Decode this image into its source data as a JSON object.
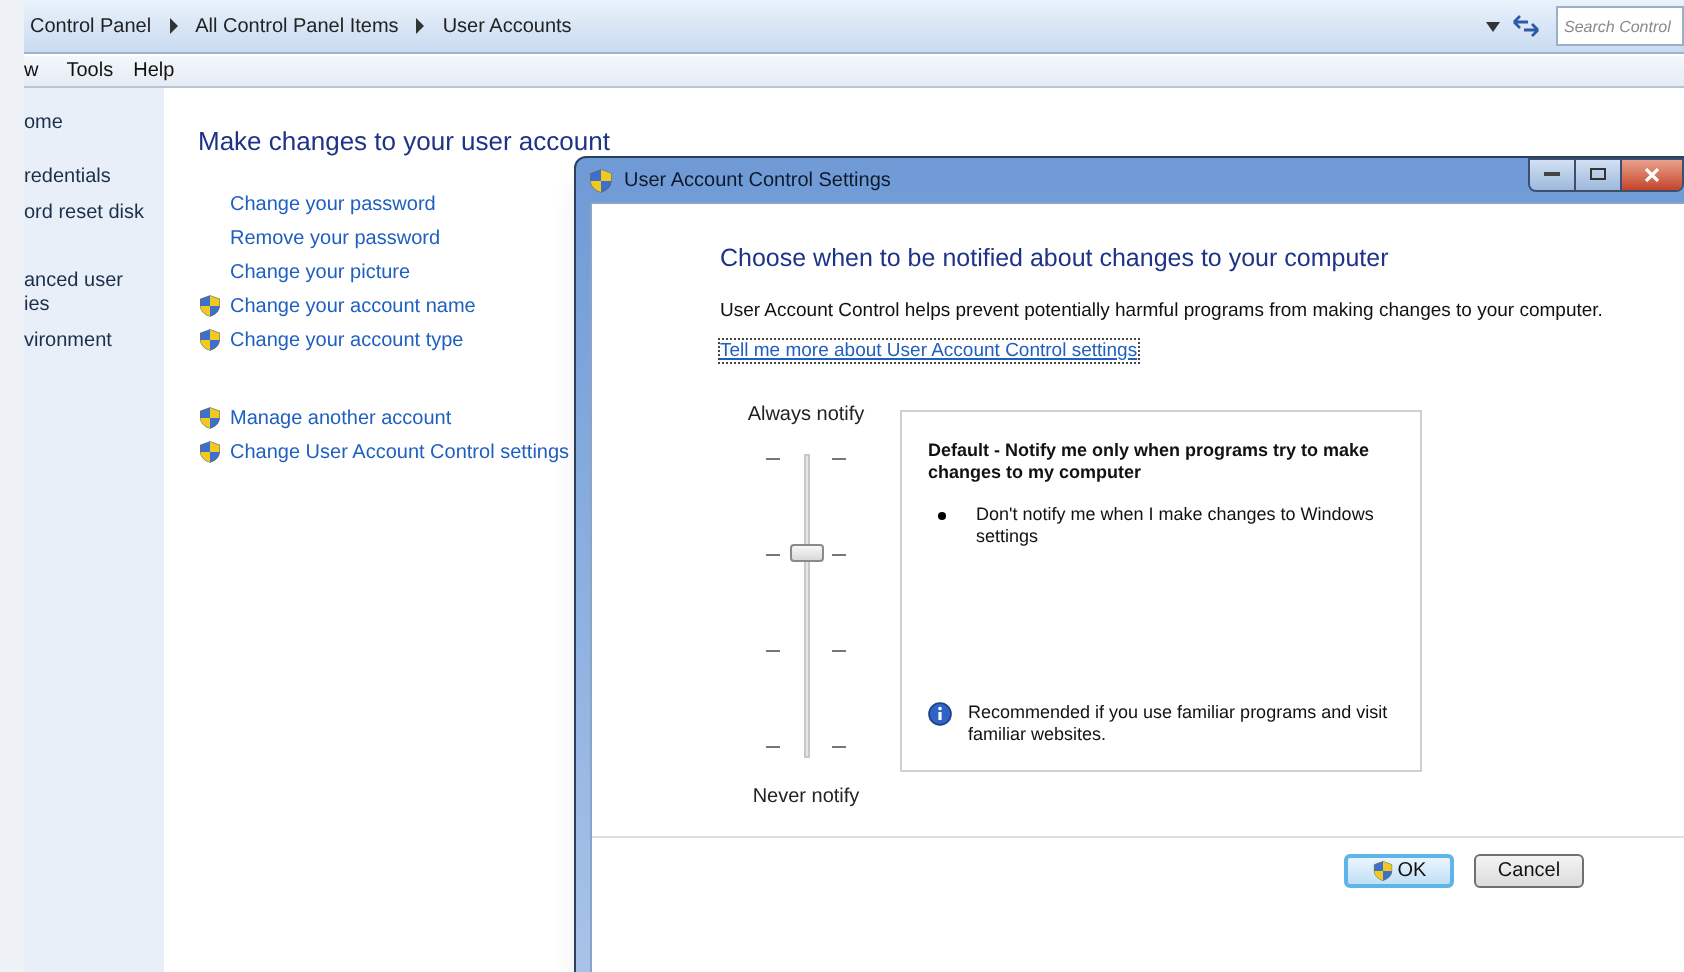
{
  "address_bar": {
    "breadcrumbs": [
      "Control Panel",
      "All Control Panel Items",
      "User Accounts"
    ],
    "search": {
      "placeholder": "Search Control"
    }
  },
  "menu_bar": [
    "w",
    "Tools",
    "Help"
  ],
  "sidebar": {
    "items": [
      {
        "lines": [
          "ome"
        ]
      },
      {
        "lines": [
          "redentials"
        ]
      },
      {
        "lines": [
          "ord reset disk"
        ]
      },
      {
        "lines": [
          "anced user",
          "ies"
        ]
      },
      {
        "lines": [
          "vironment"
        ]
      }
    ]
  },
  "main": {
    "heading": "Make changes to your user account",
    "groups": [
      [
        {
          "label": "Change your password",
          "shield": false
        },
        {
          "label": "Remove your password",
          "shield": false
        },
        {
          "label": "Change your picture",
          "shield": false
        },
        {
          "label": "Change your account name",
          "shield": true
        },
        {
          "label": "Change your account type",
          "shield": true
        }
      ],
      [
        {
          "label": "Manage another account",
          "shield": true
        },
        {
          "label": "Change User Account Control settings",
          "shield": true
        }
      ]
    ]
  },
  "dialog": {
    "title": "User Account Control Settings",
    "heading": "Choose when to be notified about changes to your computer",
    "description": "User Account Control helps prevent potentially harmful programs from making changes to your computer.",
    "link": "Tell me more about User Account Control settings",
    "slider": {
      "top_label": "Always notify",
      "bottom_label": "Never notify",
      "level": 0.67
    },
    "info": {
      "title": "Default - Notify me only when programs try to make changes to my computer",
      "bullet": "Don't notify me when I make changes to Windows settings",
      "note": "Recommended if you use familiar programs and visit familiar websites."
    },
    "buttons": [
      {
        "label": "OK",
        "shield": true,
        "default": true
      },
      {
        "label": "Cancel",
        "shield": false,
        "default": false
      }
    ]
  }
}
